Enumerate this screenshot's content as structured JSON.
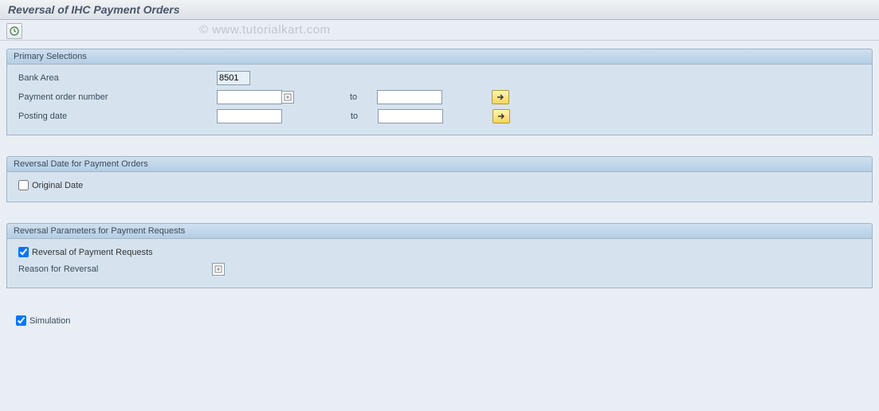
{
  "title": "Reversal of IHC Payment Orders",
  "watermark": "© www.tutorialkart.com",
  "toolbar": {
    "execute_tooltip": "Execute"
  },
  "group1": {
    "title": "Primary Selections",
    "bank_area_label": "Bank Area",
    "bank_area_value": "8501",
    "payment_order_label": "Payment order number",
    "posting_date_label": "Posting date",
    "to_label": "to"
  },
  "group2": {
    "title": "Reversal Date for Payment Orders",
    "original_date_label": "Original Date",
    "original_date_checked": false
  },
  "group3": {
    "title": "Reversal Parameters for Payment Requests",
    "reversal_requests_label": "Reversal of Payment Requests",
    "reversal_requests_checked": true,
    "reason_label": "Reason for Reversal"
  },
  "simulation": {
    "label": "Simulation",
    "checked": true
  }
}
